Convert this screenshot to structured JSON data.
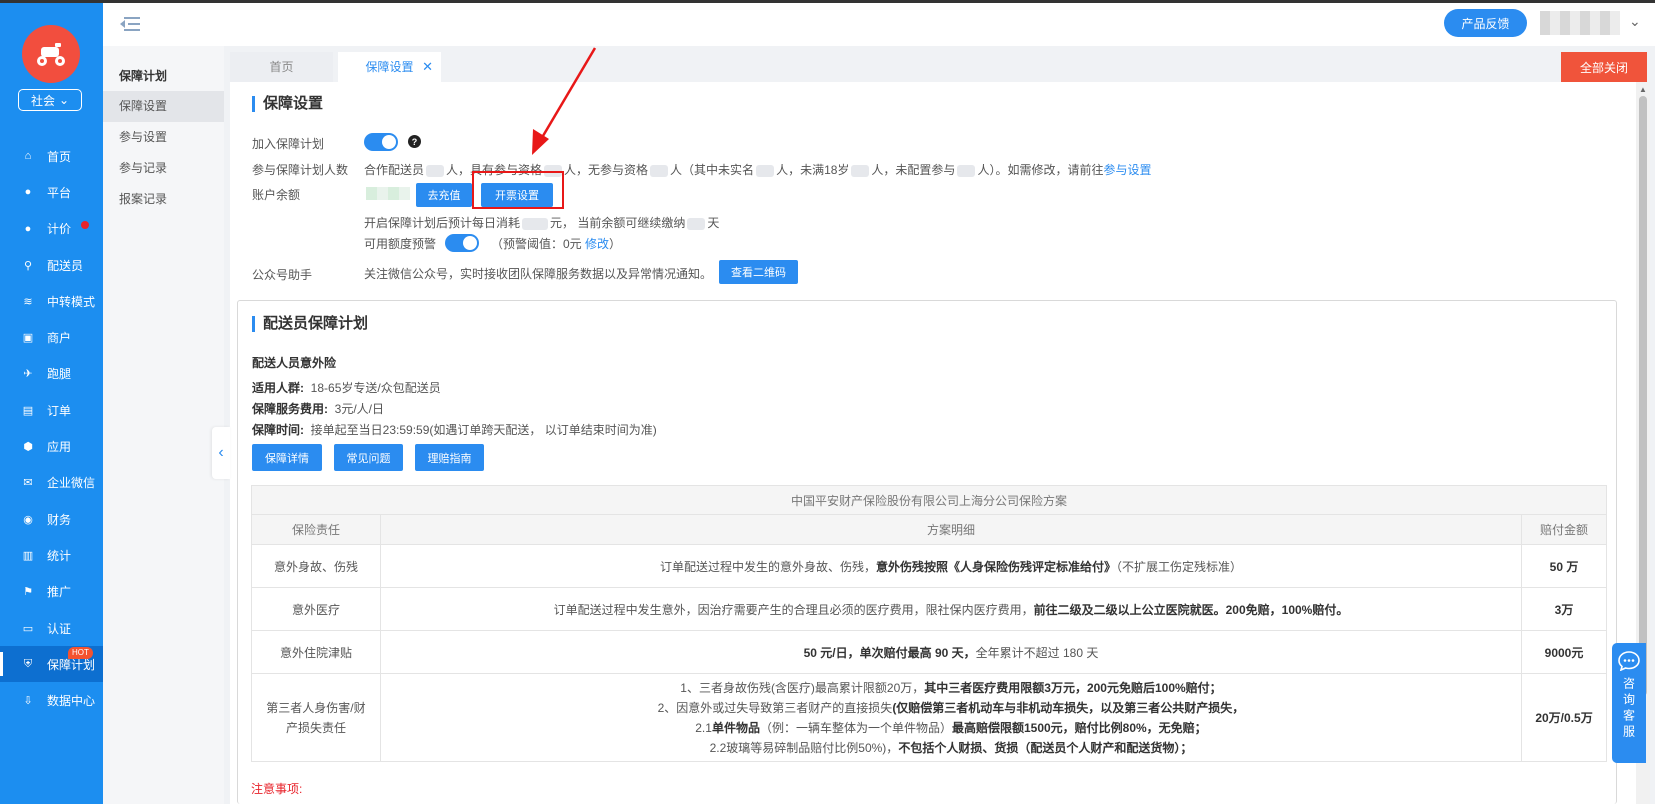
{
  "header": {
    "feedback_label": "产品反馈"
  },
  "sidebar": {
    "org_label": "社会",
    "items": [
      {
        "label": "首页",
        "icon": "home-icon"
      },
      {
        "label": "平台",
        "icon": "user-icon"
      },
      {
        "label": "计价",
        "icon": "user-icon",
        "dot": true
      },
      {
        "label": "配送员",
        "icon": "rider-icon"
      },
      {
        "label": "中转模式",
        "icon": "layers-icon"
      },
      {
        "label": "商户",
        "icon": "shop-icon"
      },
      {
        "label": "跑腿",
        "icon": "run-icon"
      },
      {
        "label": "订单",
        "icon": "order-icon"
      },
      {
        "label": "应用",
        "icon": "app-icon"
      },
      {
        "label": "企业微信",
        "icon": "chat-icon"
      },
      {
        "label": "财务",
        "icon": "finance-icon"
      },
      {
        "label": "统计",
        "icon": "chart-icon"
      },
      {
        "label": "推广",
        "icon": "flag-icon"
      },
      {
        "label": "认证",
        "icon": "id-card-icon"
      },
      {
        "label": "保障计划",
        "icon": "shield-icon",
        "hot": "HOT",
        "active": true
      },
      {
        "label": "数据中心",
        "icon": "download-icon"
      }
    ]
  },
  "submenu": {
    "title": "保障计划",
    "items": [
      "保障设置",
      "参与设置",
      "参与记录",
      "报案记录"
    ]
  },
  "tabs": {
    "home": "首页",
    "active": "保障设置",
    "close_all": "全部关闭"
  },
  "settings": {
    "title": "保障设置",
    "join_label": "加入保障计划",
    "count_label": "参与保障计划人数",
    "count_text_1": "合作配送员",
    "count_text_2": "人，具有参与资格",
    "count_text_3": "人，无参与资格",
    "count_text_4": "人（其中未实名",
    "count_text_5": "人，未满18岁",
    "count_text_6": "人，未配置参与",
    "count_text_7": "人）。如需修改，请前往",
    "count_link": "参与设置",
    "balance_label": "账户余额",
    "recharge_btn": "去充值",
    "invoice_btn": "开票设置",
    "daily_text_1": "开启保障计划后预计每日消耗",
    "daily_text_2": "元，  当前余额可继续缴纳",
    "daily_text_3": "天",
    "alert_label": "可用额度预警",
    "threshold_text": "（预警阈值：0元",
    "threshold_link": "修改",
    "threshold_close": "）",
    "wechat_label": "公众号助手",
    "wechat_text": "关注微信公众号，实时接收团队保障服务数据以及异常情况通知。",
    "qr_btn": "查看二维码"
  },
  "plan": {
    "title": "配送员保障计划",
    "subtitle": "配送人员意外险",
    "audience_label": "适用人群:",
    "audience_value": "18-65岁专送/众包配送员",
    "fee_label": "保障服务费用:",
    "fee_value": "3元/人/日",
    "time_label": "保障时间:",
    "time_value": "接单起至当日23:59:59(如遇订单跨天配送， 以订单结束时间为准)",
    "buttons": [
      "保障详情",
      "常见问题",
      "理赔指南"
    ],
    "table_caption": "中国平安财产保险股份有限公司上海分公司保险方案",
    "columns": [
      "保险责任",
      "方案明细",
      "赔付金额"
    ],
    "rows": [
      {
        "duty": "意外身故、伤残",
        "detail_plain": "订单配送过程中发生的意外身故、伤残，",
        "detail_bold": "意外伤残按照《人身保险伤残评定标准给付》",
        "detail_tail": "（不扩展工伤定残标准）",
        "amount": "50 万"
      },
      {
        "duty": "意外医疗",
        "detail_plain": "订单配送过程中发生意外，因治疗需要产生的合理且必须的医疗费用，限社保内医疗费用，",
        "detail_bold": "前往二级及二级以上公立医院就医。200免赔，100%赔付。",
        "detail_tail": "",
        "amount": "3万"
      },
      {
        "duty": "意外住院津贴",
        "detail_plain": "",
        "detail_bold": "50 元/日，单次赔付最高 90 天，",
        "detail_tail": "全年累计不超过 180 天",
        "amount": "9000元"
      }
    ],
    "third_party": {
      "duty": "第三者人身伤害/财产损失责任",
      "line1_plain": "1、三者身故伤残(含医疗)最高累计限额20万，",
      "line1_bold": "其中三者医疗费用限额3万元，200元免赔后100%赔付；",
      "line2_plain": "2、因意外或过失导致第三者财产的直接损失",
      "line2_bold": "(仅赔偿第三者机动车与非机动车损失，以及第三者公共财产损失，",
      "line3_plain": "2.1",
      "line3_bold": "单件物品",
      "line3_mid": "（例：一辆车整体为一个单件物品）",
      "line3_bold2": "最高赔偿限额1500元，赔付比例80%，无免赔；",
      "line4_plain": "2.2玻璃等易碎制品赔付比例50%)，",
      "line4_bold": "不包括个人财损、货损（配送员个人财产和配送货物）；",
      "amount": "20万/0.5万"
    },
    "notice": "注意事项:"
  },
  "service": {
    "label": "咨询客服"
  },
  "colors": {
    "sidebar": "#1c8ef0",
    "primary": "#2b8cf0",
    "danger": "#f0543b",
    "highlight_box": "#e81818"
  }
}
